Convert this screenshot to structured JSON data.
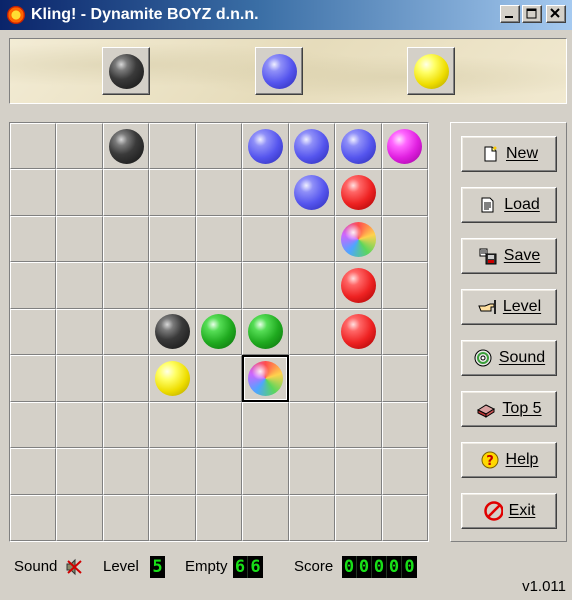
{
  "window": {
    "title": "Kling! - Dynamite BOYZ d.n.n.",
    "icon": "sun-icon",
    "controls": [
      "minimize",
      "maximize",
      "close"
    ]
  },
  "next_balls": [
    "black",
    "blue",
    "yellow"
  ],
  "board": {
    "rows": 9,
    "cols": 9,
    "selected": [
      5,
      5
    ],
    "cells": [
      [
        "",
        "",
        "black",
        "",
        "",
        "blue",
        "blue",
        "blue",
        "magenta"
      ],
      [
        "",
        "",
        "",
        "",
        "",
        "",
        "blue",
        "red",
        ""
      ],
      [
        "",
        "",
        "",
        "",
        "",
        "",
        "",
        "rainbow",
        ""
      ],
      [
        "",
        "",
        "",
        "",
        "",
        "",
        "",
        "red",
        ""
      ],
      [
        "",
        "",
        "",
        "black",
        "green",
        "green",
        "",
        "red",
        ""
      ],
      [
        "",
        "",
        "",
        "yellow",
        "",
        "rainbow",
        "",
        "",
        ""
      ],
      [
        "",
        "",
        "",
        "",
        "",
        "",
        "",
        "",
        ""
      ],
      [
        "",
        "",
        "",
        "",
        "",
        "",
        "",
        "",
        ""
      ],
      [
        "",
        "",
        "",
        "",
        "",
        "",
        "",
        "",
        ""
      ]
    ]
  },
  "buttons": [
    {
      "key": "new",
      "label": "New",
      "icon": "new-document-icon"
    },
    {
      "key": "load",
      "label": "Load",
      "icon": "open-document-icon"
    },
    {
      "key": "save",
      "label": "Save",
      "icon": "save-disk-icon"
    },
    {
      "key": "level",
      "label": "Level",
      "icon": "pointing-hand-icon"
    },
    {
      "key": "sound",
      "label": "Sound",
      "icon": "cd-icon"
    },
    {
      "key": "top5",
      "label": "Top 5",
      "icon": "trophy-box-icon"
    },
    {
      "key": "help",
      "label": "Help",
      "icon": "help-icon"
    },
    {
      "key": "exit",
      "label": "Exit",
      "icon": "no-entry-icon"
    }
  ],
  "status": {
    "sound_label": "Sound",
    "sound_icon": "speaker-muted-icon",
    "level_label": "Level",
    "level_value": "5",
    "empty_label": "Empty",
    "empty_value": "66",
    "score_label": "Score",
    "score_value": "00000",
    "lcd_color": "#18e018"
  },
  "version": "v1.011"
}
